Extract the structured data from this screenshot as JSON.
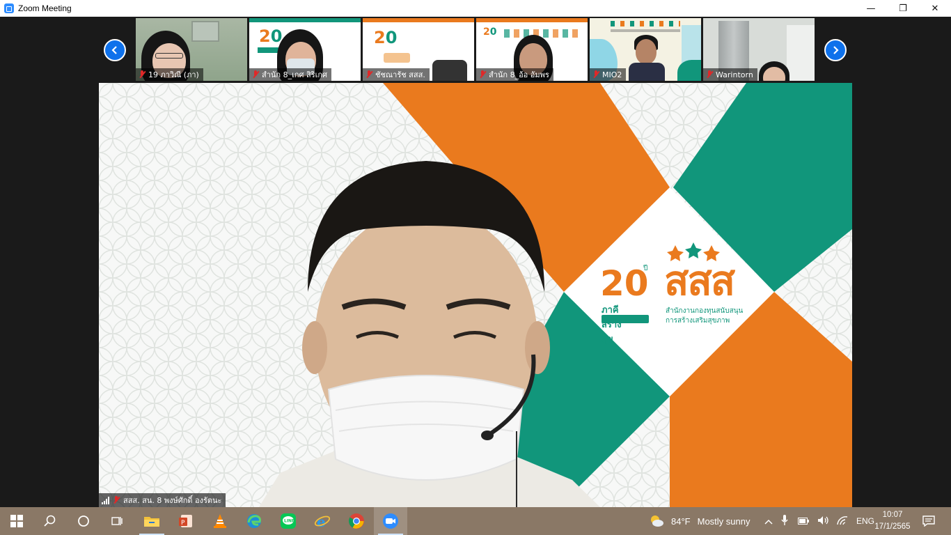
{
  "window": {
    "title": "Zoom Meeting",
    "minimize": "—",
    "maximize": "❐",
    "close": "✕"
  },
  "filmstrip": {
    "participants": [
      {
        "name": "19 ภาวิณี  (ภา)"
      },
      {
        "name": "สำนัก 8_เกศ สิริเกศ"
      },
      {
        "name": "ชัชณารัช สสส."
      },
      {
        "name": "สำนัก 8_อ้อ อัมพร"
      },
      {
        "name": "MIO2"
      },
      {
        "name": "Warintorn"
      }
    ]
  },
  "main_video": {
    "speaker_name": "สสส. สน. 8 พงษ์ศักดิ์ องรัตนะ",
    "logo": {
      "anniversary": "20",
      "anniversary_sup": "ปี",
      "anniversary_sub": "ภาคีสร้างสุข",
      "org_short": "สสส",
      "org_line1": "สำนักงานกองทุนสนับสนุน",
      "org_line2": "การสร้างเสริมสุขภาพ"
    }
  },
  "taskbar": {
    "weather_temp": "84°F",
    "weather_text": "Mostly sunny",
    "language": "ENG",
    "time": "10:07",
    "date": "17/1/2565"
  },
  "colors": {
    "zoom_blue": "#0e71eb",
    "brand_orange": "#ea7a1e",
    "brand_green": "#11967b",
    "taskbar": "#8a7866"
  }
}
